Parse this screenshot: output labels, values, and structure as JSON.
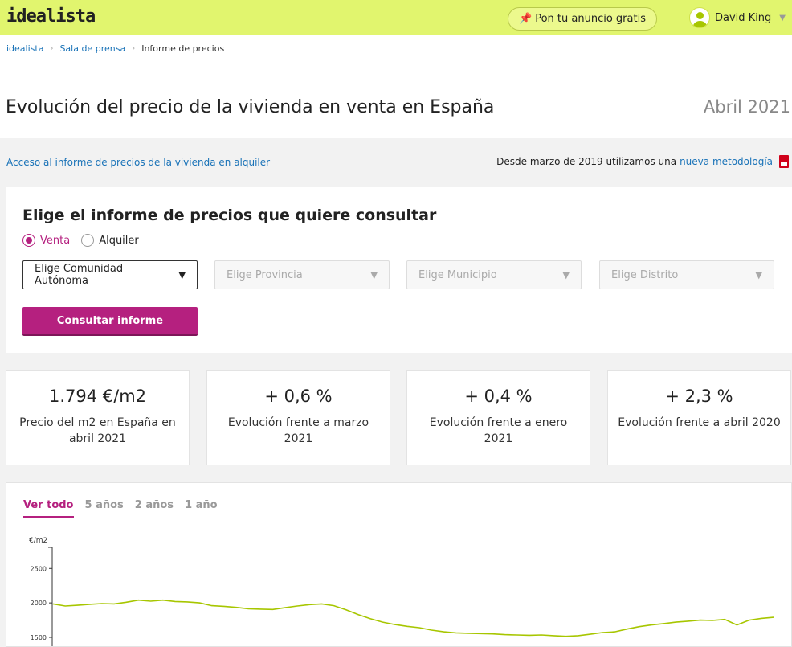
{
  "header": {
    "logo": "idealista",
    "cta_label": "Pon tu anuncio gratis",
    "user_name": "David King",
    "brand_color": "#e1f56e",
    "accent_color": "#b5207f"
  },
  "breadcrumb": [
    "idealista",
    "Sala de prensa",
    "Informe de precios"
  ],
  "page": {
    "title": "Evolución del precio de la vivienda en venta en España",
    "date": "Abril 2021"
  },
  "info_bar": {
    "rent_link": "Acceso al informe de precios de la vivienda en alquiler",
    "method_text": "Desde marzo de 2019 utilizamos una",
    "method_link": "nueva metodología"
  },
  "selector": {
    "heading": "Elige el informe de precios que quiere consultar",
    "radio_sale": "Venta",
    "radio_rent": "Alquiler",
    "selected": "Venta",
    "community": "Elige Comunidad Autónoma",
    "province": "Elige Provincia",
    "municipality": "Elige Municipio",
    "district": "Elige Distrito",
    "submit": "Consultar informe"
  },
  "stats": [
    {
      "value": "1.794 €/m2",
      "label": "Precio del m2 en España en abril 2021"
    },
    {
      "value": "+ 0,6 %",
      "label": "Evolución frente a marzo 2021"
    },
    {
      "value": "+ 0,4 %",
      "label": "Evolución frente a enero 2021"
    },
    {
      "value": "+ 2,3 %",
      "label": "Evolución frente a abril 2020"
    }
  ],
  "chart_tabs": [
    "Ver todo",
    "5 años",
    "2 años",
    "1 año"
  ],
  "chart_data": {
    "type": "line",
    "ylabel": "€/m2",
    "yticks": [
      2500,
      2000,
      1500
    ],
    "ylim": [
      1450,
      2700
    ],
    "series": [
      {
        "color": "#a7c600",
        "values": [
          1985,
          1955,
          1965,
          1980,
          1990,
          1985,
          2010,
          2040,
          2025,
          2040,
          2020,
          2015,
          2000,
          1960,
          1950,
          1935,
          1915,
          1910,
          1905,
          1930,
          1955,
          1975,
          1985,
          1960,
          1900,
          1830,
          1770,
          1720,
          1685,
          1660,
          1640,
          1605,
          1580,
          1565,
          1560,
          1555,
          1550,
          1540,
          1535,
          1530,
          1535,
          1525,
          1515,
          1525,
          1545,
          1570,
          1580,
          1620,
          1655,
          1680,
          1700,
          1720,
          1735,
          1750,
          1745,
          1760,
          1680,
          1750,
          1775,
          1790
        ]
      }
    ]
  }
}
